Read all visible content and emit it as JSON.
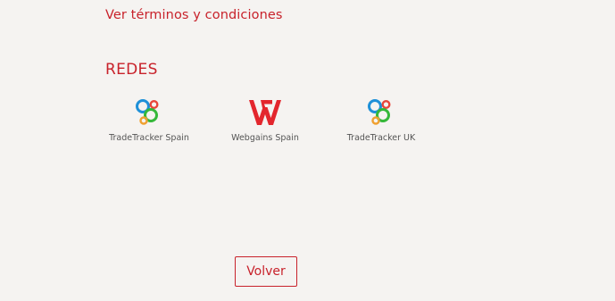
{
  "terms": {
    "link_label": "Ver términos y condiciones"
  },
  "networks": {
    "title": "REDES",
    "items": [
      {
        "name": "TradeTracker Spain",
        "icon": "tradetracker-logo-icon"
      },
      {
        "name": "Webgains Spain",
        "icon": "webgains-logo-icon"
      },
      {
        "name": "TradeTracker UK",
        "icon": "tradetracker-logo-icon"
      }
    ]
  },
  "actions": {
    "back_label": "Volver"
  },
  "colors": {
    "accent": "#c8222b",
    "background": "#f5f3f1",
    "text_muted": "#555555",
    "tradetracker_blue": "#1e90d8",
    "tradetracker_red": "#e8463a",
    "tradetracker_green": "#35b83a",
    "tradetracker_orange": "#f0a030",
    "webgains_red": "#e3262d"
  }
}
